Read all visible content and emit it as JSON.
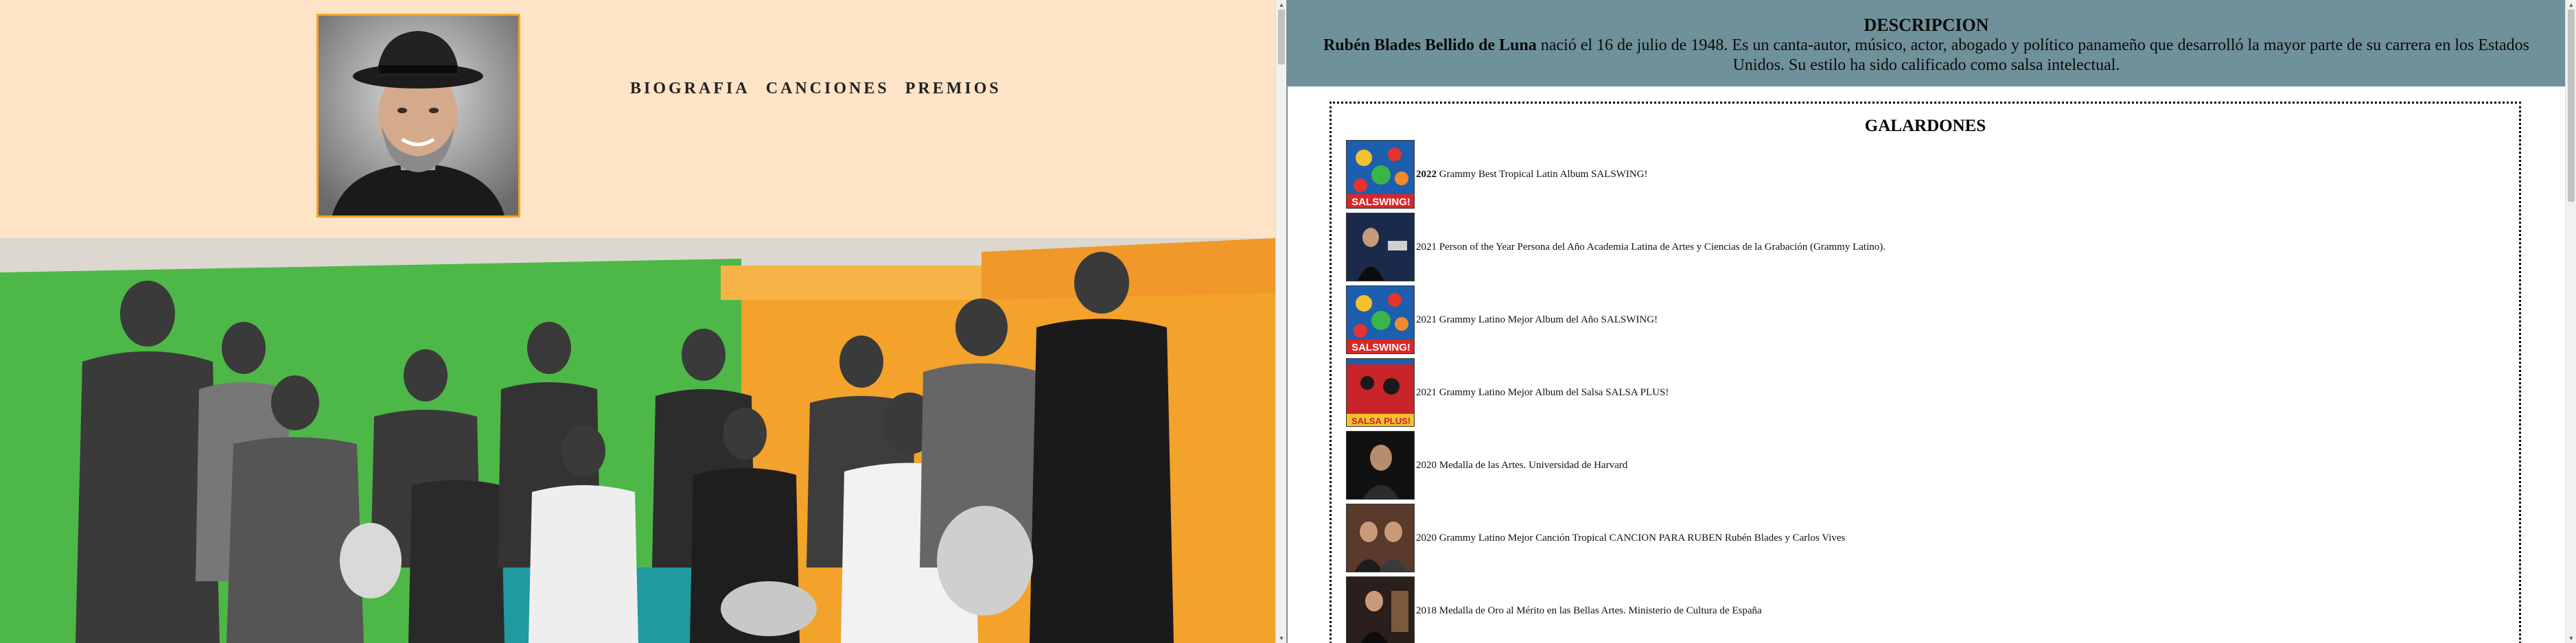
{
  "nav": {
    "links": [
      "BIOGRAFIA",
      "CANCIONES",
      "PREMIOS"
    ]
  },
  "description": {
    "title": "DESCRIPCION",
    "name": "Rubén Blades Bellido de Luna",
    "text": " nació el 16 de julio de 1948. Es un canta-autor, músico, actor, abogado y político panameño que desarrolló la mayor parte de su carrera en los Estados Unidos. Su estilo ha sido calificado como salsa intelectual."
  },
  "awards": {
    "title": "GALARDONES",
    "items": [
      {
        "year": "2022",
        "year_bold": true,
        "text": " Grammy Best Tropical Latin Album SALSWING!"
      },
      {
        "year": "2021",
        "year_bold": false,
        "text": " Person of the Year Persona del Año Academia Latina de Artes y Ciencias de la Grabación (Grammy Latino)."
      },
      {
        "year": "2021",
        "year_bold": false,
        "text": " Grammy Latino Mejor Album del Año SALSWING!"
      },
      {
        "year": "2021",
        "year_bold": false,
        "text": " Grammy Latino Mejor Album del Salsa SALSA PLUS!"
      },
      {
        "year": "2020",
        "year_bold": false,
        "text": " Medalla de las Artes. Universidad de Harvard"
      },
      {
        "year": "2020",
        "year_bold": false,
        "text": " Grammy Latino Mejor Canción Tropical CANCION PARA RUBEN Rubén Blades y Carlos Vives"
      },
      {
        "year": "2018",
        "year_bold": false,
        "text": " Medalla de Oro al Mérito en las Bellas Artes. Ministerio de Cultura de España"
      }
    ]
  },
  "thumb_labels": [
    "SALSWING!",
    "SALSWING!",
    "SALSA PLUS!"
  ],
  "colors": {
    "left_bg": "#ffe3c7",
    "desc_bg": "#6f9199",
    "accent_orange": "#f5a623",
    "wall_green": "#4db847"
  }
}
